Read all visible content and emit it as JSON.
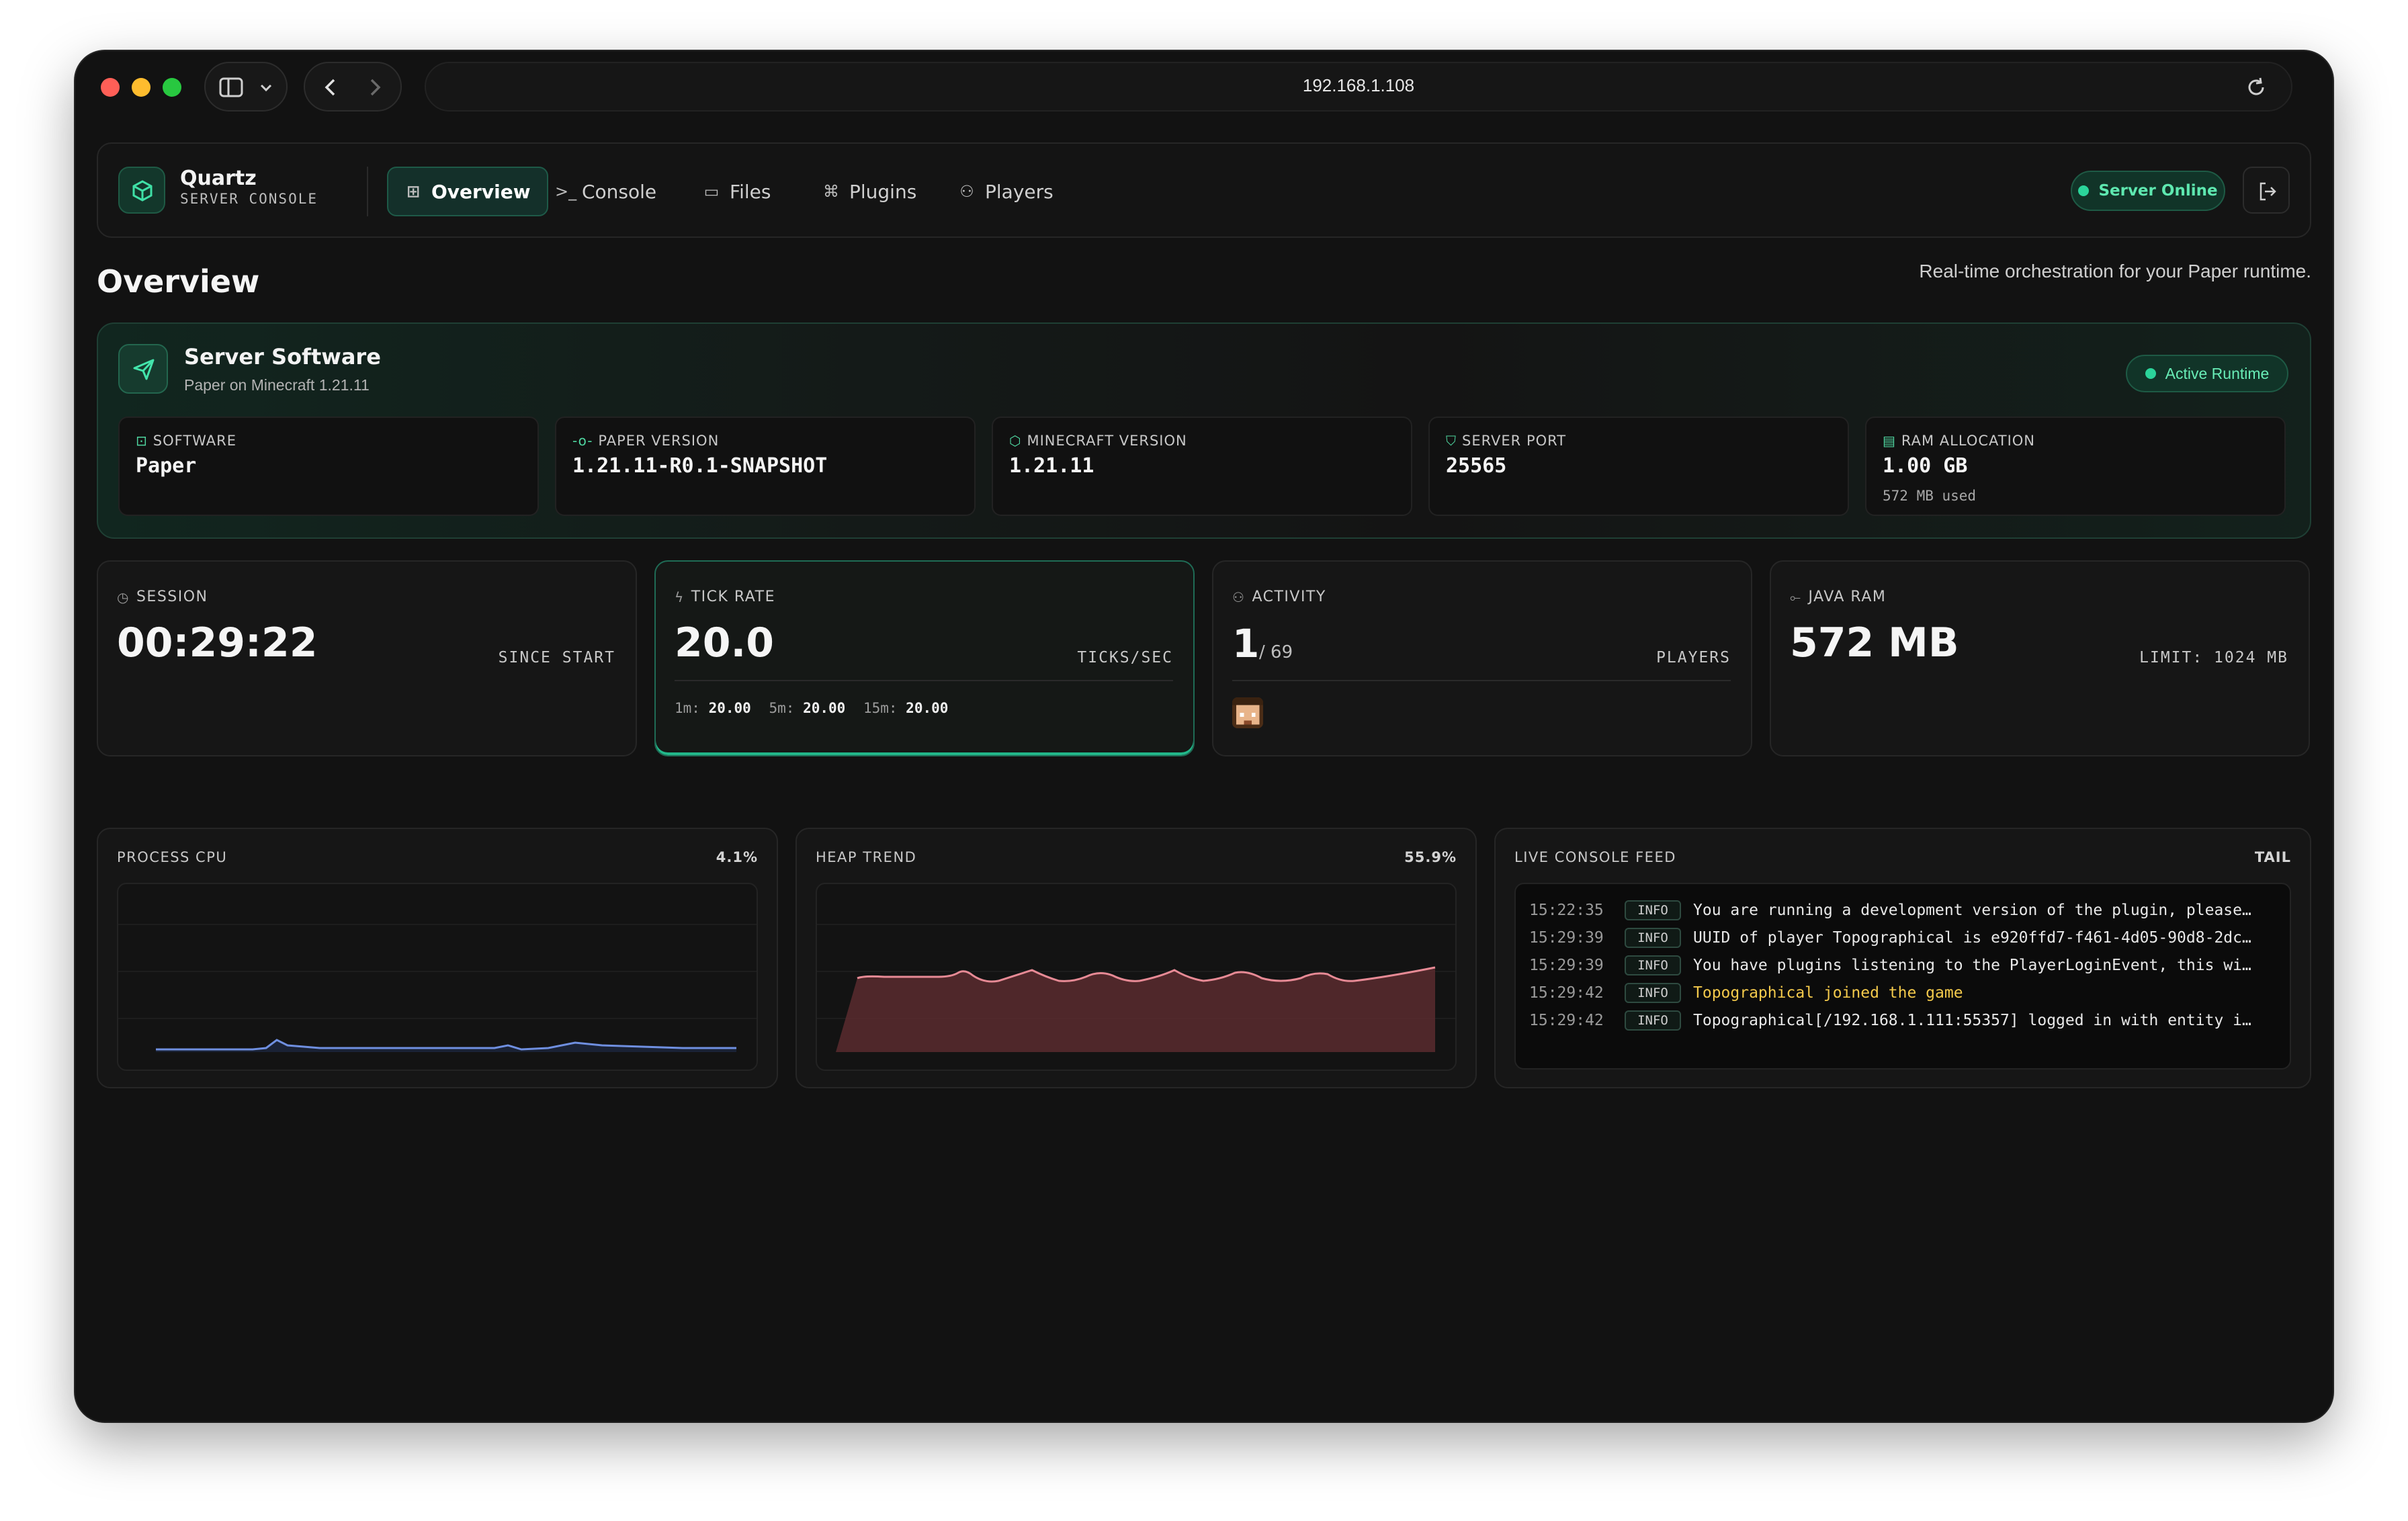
{
  "browser": {
    "url": "192.168.1.108"
  },
  "app": {
    "brand_name": "Quartz",
    "brand_sub": "SERVER CONSOLE",
    "tabs": [
      {
        "label": "Overview",
        "icon": "grid-icon",
        "active": true
      },
      {
        "label": "Console",
        "icon": "terminal-icon",
        "active": false
      },
      {
        "label": "Files",
        "icon": "folder-icon",
        "active": false
      },
      {
        "label": "Plugins",
        "icon": "puzzle-icon",
        "active": false
      },
      {
        "label": "Players",
        "icon": "users-icon",
        "active": false
      }
    ],
    "status": "Server Online",
    "accent_color": "#2bd49a"
  },
  "header": {
    "title": "Overview",
    "subtitle": "Real-time orchestration for your Paper runtime."
  },
  "software": {
    "title": "Server Software",
    "subtitle": "Paper on Minecraft 1.21.11",
    "badge": "Active Runtime",
    "specs": [
      {
        "label": "SOFTWARE",
        "value": "Paper",
        "note": ""
      },
      {
        "label": "PAPER VERSION",
        "value": "1.21.11-R0.1-SNAPSHOT",
        "note": ""
      },
      {
        "label": "MINECRAFT VERSION",
        "value": "1.21.11",
        "note": ""
      },
      {
        "label": "SERVER PORT",
        "value": "25565",
        "note": ""
      },
      {
        "label": "RAM ALLOCATION",
        "value": "1.00 GB",
        "note": "572 MB used"
      }
    ]
  },
  "stats": {
    "session": {
      "label": "SESSION",
      "value": "00:29:22",
      "unit": "SINCE START"
    },
    "tick": {
      "label": "TICK RATE",
      "value": "20.0",
      "unit": "TICKS/SEC",
      "m1_label": "1m:",
      "m1": "20.00",
      "m5_label": "5m:",
      "m5": "20.00",
      "m15_label": "15m:",
      "m15": "20.00"
    },
    "activity": {
      "label": "ACTIVITY",
      "value": "1",
      "max": "/ 69",
      "unit": "PLAYERS"
    },
    "ram": {
      "label": "JAVA RAM",
      "value": "572 MB",
      "unit": "LIMIT: 1024 MB"
    }
  },
  "panels": {
    "cpu": {
      "label": "PROCESS CPU",
      "value": "4.1%"
    },
    "heap": {
      "label": "HEAP TREND",
      "value": "55.9%"
    },
    "console": {
      "label": "LIVE CONSOLE FEED",
      "tail": "TAIL"
    }
  },
  "logs": [
    {
      "time": "15:22:35",
      "level": "INFO",
      "msg": "You are running a development version of the plugin, please…",
      "highlight": false
    },
    {
      "time": "15:29:39",
      "level": "INFO",
      "msg": "UUID of player Topographical is e920ffd7-f461-4d05-90d8-2dc…",
      "highlight": false
    },
    {
      "time": "15:29:39",
      "level": "INFO",
      "msg": "You have plugins listening to the PlayerLoginEvent, this wi…",
      "highlight": false
    },
    {
      "time": "15:29:42",
      "level": "INFO",
      "msg": "Topographical joined the game",
      "highlight": true
    },
    {
      "time": "15:29:42",
      "level": "INFO",
      "msg": "Topographical[/192.168.1.111:55357] logged in with entity i…",
      "highlight": false
    }
  ]
}
